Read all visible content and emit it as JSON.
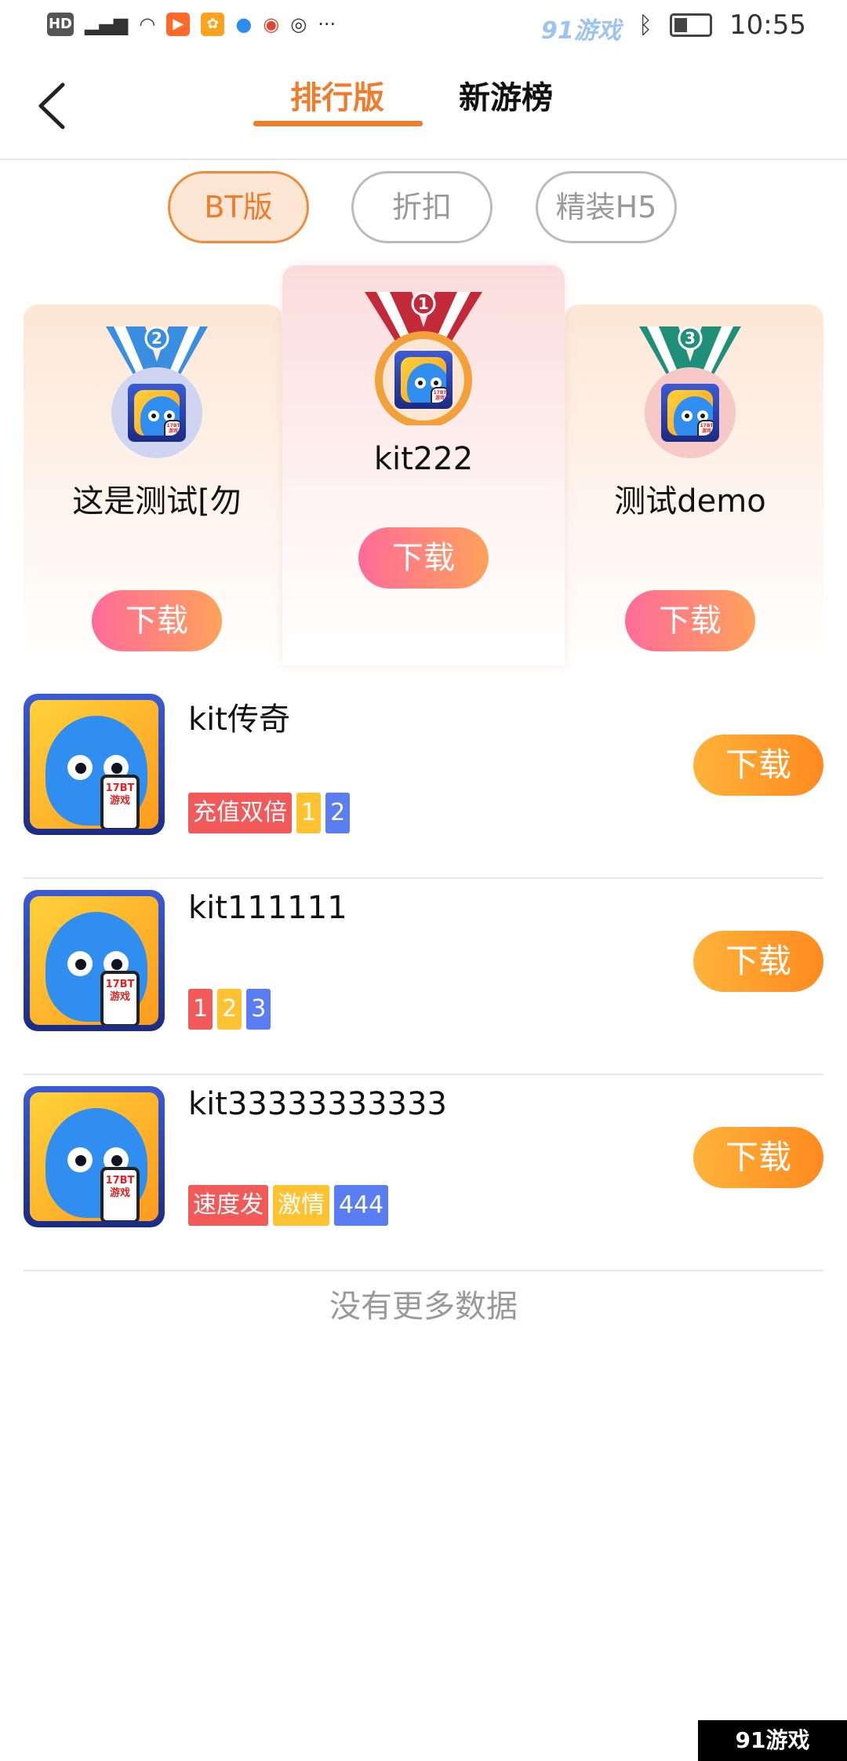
{
  "status_bar": {
    "left_text": "HD ⁴ᴳ",
    "watermark": "91游戏",
    "time": "10:55"
  },
  "header": {
    "tabs": [
      {
        "label": "排行版",
        "active": true
      },
      {
        "label": "新游榜",
        "active": false
      }
    ]
  },
  "filters": [
    {
      "label": "BT版",
      "active": true
    },
    {
      "label": "折扣",
      "active": false
    },
    {
      "label": "精装H5",
      "active": false
    }
  ],
  "podium": [
    {
      "rank": "2",
      "name": "这是测试[勿",
      "button": "下载",
      "ribbon_color": "#3a8ee0",
      "ring_color": "#cfd5f0"
    },
    {
      "rank": "1",
      "name": "kit222",
      "button": "下载",
      "ribbon_color": "#c22a3a",
      "ring_color": "#f2a03a"
    },
    {
      "rank": "3",
      "name": "测试demo",
      "button": "下载",
      "ribbon_color": "#1f8f7a",
      "ring_color": "#f6c8c8"
    }
  ],
  "games": [
    {
      "title": "kit传奇",
      "button": "下载",
      "tags": [
        {
          "text": "充值双倍",
          "color": "#f25a5a"
        },
        {
          "text": "1",
          "color": "#ffc332"
        },
        {
          "text": "2",
          "color": "#5a7ef2"
        }
      ]
    },
    {
      "title": "kit111111",
      "button": "下载",
      "tags": [
        {
          "text": "1",
          "color": "#f25a5a"
        },
        {
          "text": "2",
          "color": "#ffc332"
        },
        {
          "text": "3",
          "color": "#5a7ef2"
        }
      ]
    },
    {
      "title": "kit33333333333",
      "button": "下载",
      "tags": [
        {
          "text": "速度发",
          "color": "#f25a5a"
        },
        {
          "text": "激情",
          "color": "#ffc332"
        },
        {
          "text": "444",
          "color": "#5a7ef2"
        }
      ]
    }
  ],
  "app_icon_text": "17BT游戏",
  "footer_text": "没有更多数据",
  "corner_watermark": "91游戏"
}
